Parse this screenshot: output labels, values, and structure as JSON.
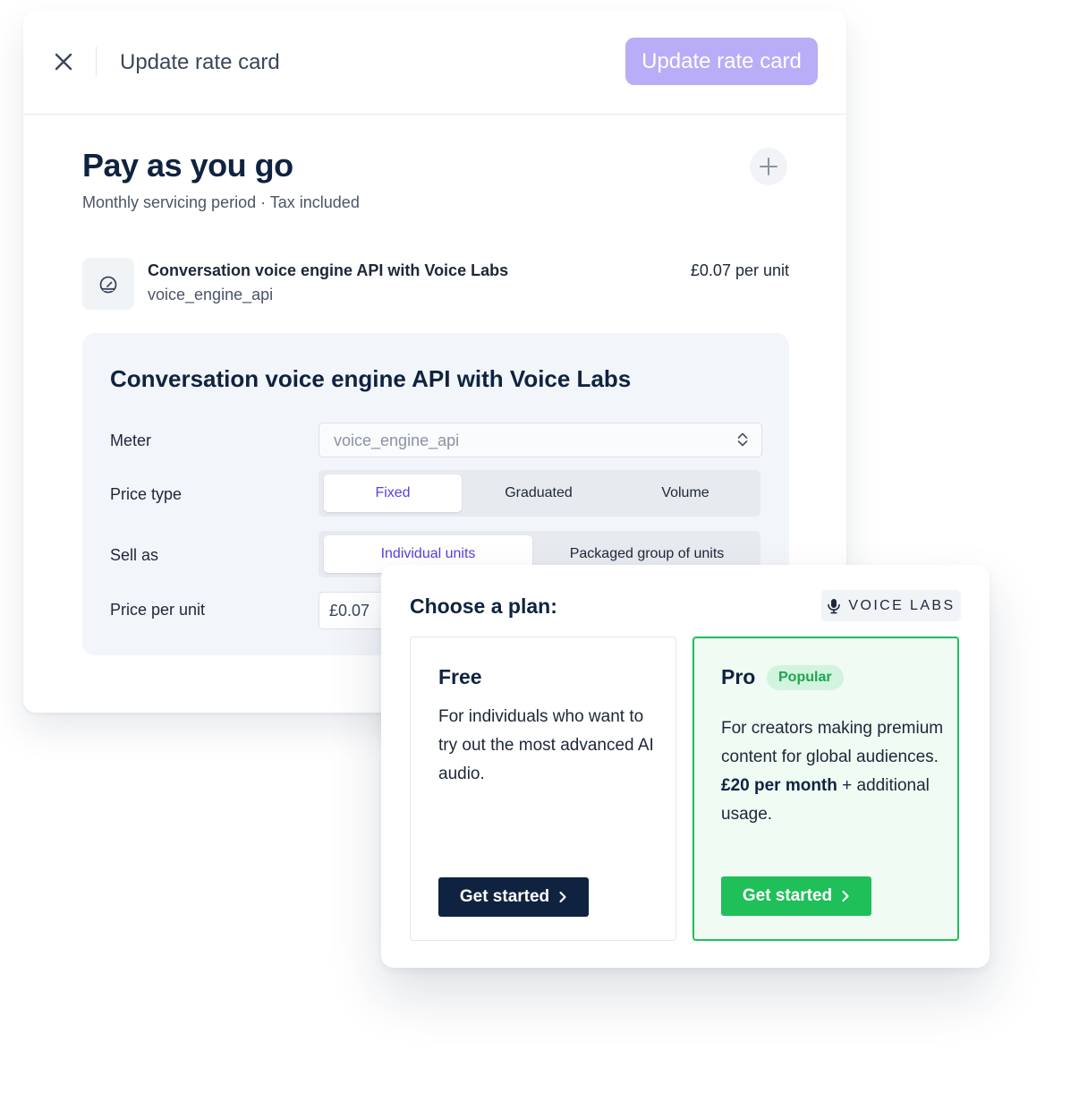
{
  "header": {
    "title": "Update rate card",
    "update_button_label": "Update rate card",
    "colors": {
      "update_button": "#b9adf8"
    }
  },
  "pricing": {
    "title": "Pay as you go",
    "subtitle": "Monthly servicing period · Tax included",
    "product": {
      "icon": "gauge-icon",
      "name": "Conversation voice engine API with Voice Labs",
      "code": "voice_engine_api",
      "price": "£0.07 per unit"
    }
  },
  "details": {
    "title": "Conversation voice engine API with Voice Labs",
    "meter": {
      "label": "Meter",
      "value": "voice_engine_api"
    },
    "price_type": {
      "label": "Price type",
      "options": [
        "Fixed",
        "Graduated",
        "Volume"
      ],
      "selected": "Fixed"
    },
    "sell_as": {
      "label": "Sell as",
      "options": [
        "Individual units",
        "Packaged group of units"
      ],
      "selected": "Individual units"
    },
    "price_per_unit": {
      "label": "Price per unit",
      "value": "£0.07"
    }
  },
  "plans": {
    "title": "Choose a plan:",
    "brand_badge": "VOICE LABS",
    "free": {
      "name": "Free",
      "description": "For individuals who want to try out the most advanced AI audio.",
      "cta": "Get started"
    },
    "pro": {
      "name": "Pro",
      "badge": "Popular",
      "description": "For creators making premium content for global audiences.",
      "price": "£20 per month",
      "price_suffix": " + additional usage.",
      "cta": "Get started"
    },
    "colors": {
      "accent_green": "#1fbf5a",
      "dark_navy": "#0f2340",
      "active_purple": "#5b3ee0"
    }
  }
}
